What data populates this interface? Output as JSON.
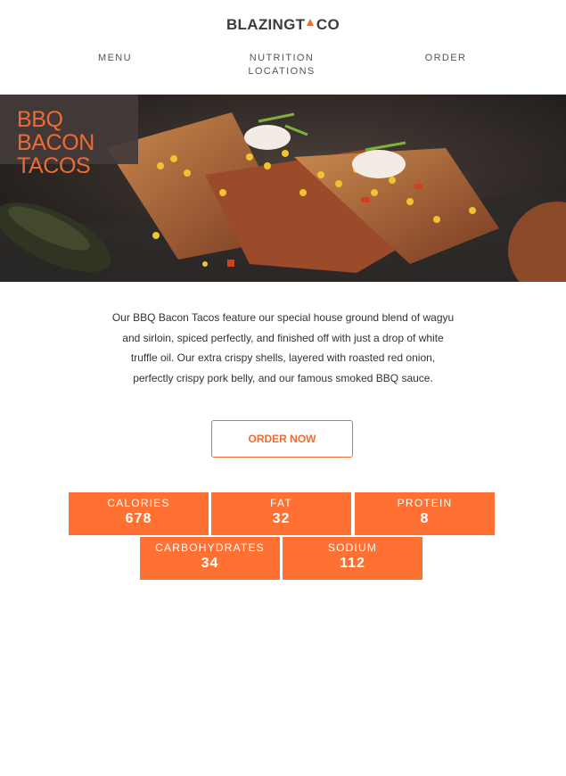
{
  "brand": {
    "name_part1": "BLAZING",
    "name_a": "A",
    "name_part2": "T",
    "name_part3": "CO"
  },
  "nav": {
    "menu": "MENU",
    "nutrition": "NUTRITION",
    "locations": "LOCATIONS",
    "order": "ORDER"
  },
  "hero": {
    "title_line1": "BBQ BACON",
    "title_line2": "TACOS"
  },
  "description": {
    "line1": "Our BBQ Bacon Tacos feature our special house ground blend of wagyu",
    "line2": "and sirloin, spiced perfectly, and finished off with just a drop of white",
    "line3": "truffle oil. Our extra crispy shells, layered with roasted red onion,",
    "line4": "perfectly crispy pork belly, and our famous smoked BBQ sauce."
  },
  "order_button": "ORDER NOW",
  "nutrition": [
    {
      "label": "CALORIES",
      "value": "678"
    },
    {
      "label": "FAT",
      "value": "32"
    },
    {
      "label": "PROTEIN",
      "value": "8"
    },
    {
      "label": "CARBOHYDRATES",
      "value": "34"
    },
    {
      "label": "SODIUM",
      "value": "112"
    }
  ],
  "colors": {
    "accent": "#ef6b32",
    "tile": "#ff7132",
    "title_panel": "#443a3a"
  }
}
